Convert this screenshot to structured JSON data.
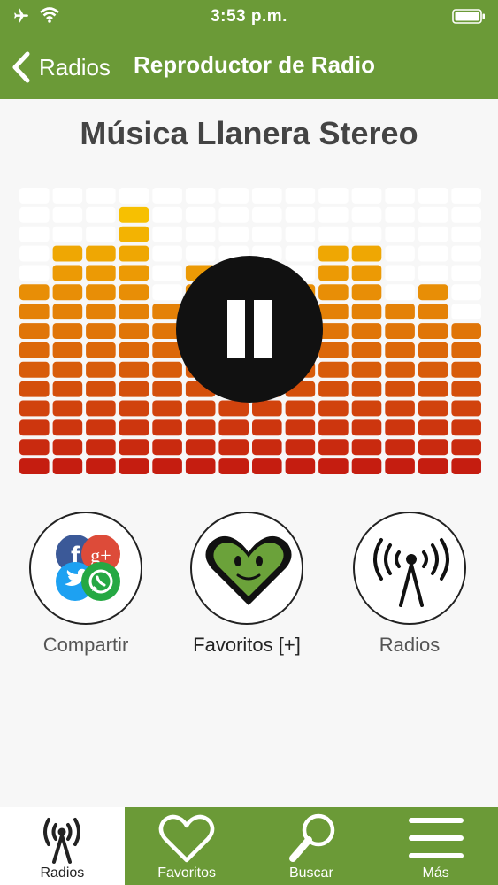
{
  "status_bar": {
    "time": "3:53 p.m."
  },
  "nav": {
    "back_label": "Radios",
    "title": "Reproductor de Radio"
  },
  "station": {
    "name": "Música Llanera Stereo"
  },
  "player": {
    "state": "playing",
    "icon": "pause-icon"
  },
  "equalizer": {
    "columns": 14,
    "rows": 15,
    "levels": [
      10,
      12,
      12,
      14,
      9,
      11,
      11,
      11,
      10,
      12,
      12,
      9,
      10,
      8
    ],
    "colors": {
      "off": "#ffffff",
      "bottom": "#c51d10",
      "top": "#fbcc00"
    }
  },
  "actions": [
    {
      "label": "Compartir",
      "icon": "share-social-icon"
    },
    {
      "label": "Favoritos [+]",
      "icon": "heart-face-icon"
    },
    {
      "label": "Radios",
      "icon": "radio-antenna-icon"
    }
  ],
  "tabs": [
    {
      "label": "Radios",
      "icon": "radio-antenna-icon",
      "active": true
    },
    {
      "label": "Favoritos",
      "icon": "heart-icon",
      "active": false
    },
    {
      "label": "Buscar",
      "icon": "search-icon",
      "active": false
    },
    {
      "label": "Más",
      "icon": "menu-icon",
      "active": false
    }
  ],
  "colors": {
    "brand_green": "#6b9a37",
    "background": "#f7f7f7"
  }
}
